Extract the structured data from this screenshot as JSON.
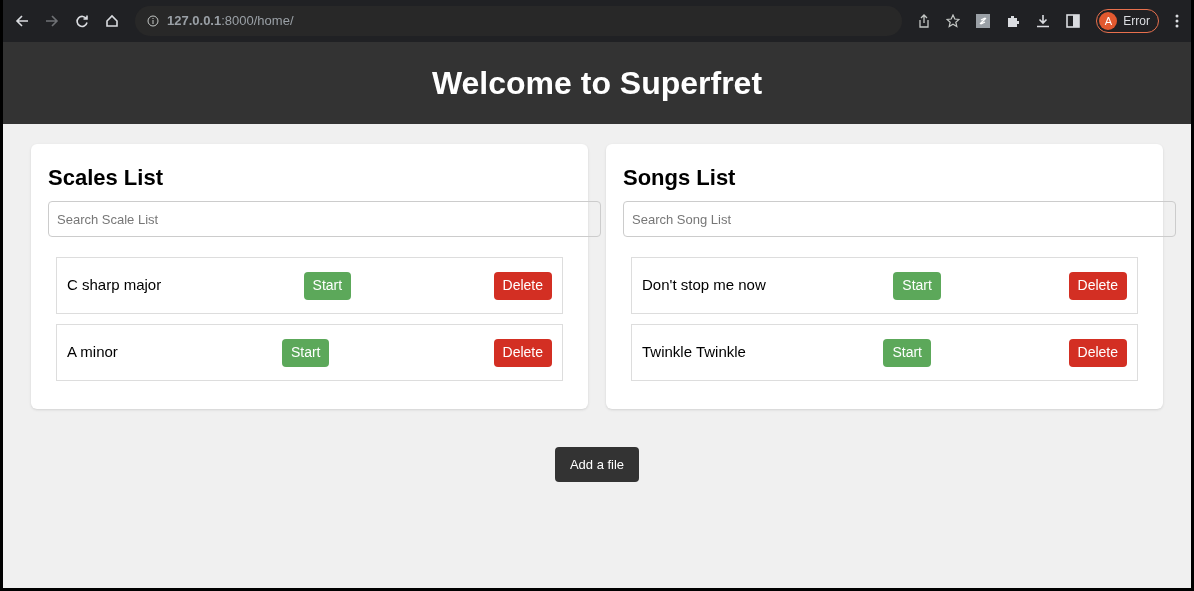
{
  "browser": {
    "url": "**127.0.0.1**:8000/home/",
    "profile_initial": "A",
    "profile_status": "Error"
  },
  "header": {
    "title": "Welcome to Superfret"
  },
  "lists": [
    {
      "title": "Scales List",
      "search": {
        "placeholder": "Search Scale List"
      },
      "items": [
        {
          "name": "C sharp major",
          "start": "Start",
          "delete": "Delete"
        },
        {
          "name": "A minor",
          "start": "Start",
          "delete": "Delete"
        }
      ]
    },
    {
      "title": "Songs List",
      "search": {
        "placeholder": "Search Song List"
      },
      "items": [
        {
          "name": "Don't stop me now",
          "start": "Start",
          "delete": "Delete"
        },
        {
          "name": "Twinkle Twinkle",
          "start": "Start",
          "delete": "Delete"
        }
      ]
    }
  ],
  "add_button": "Add a file"
}
